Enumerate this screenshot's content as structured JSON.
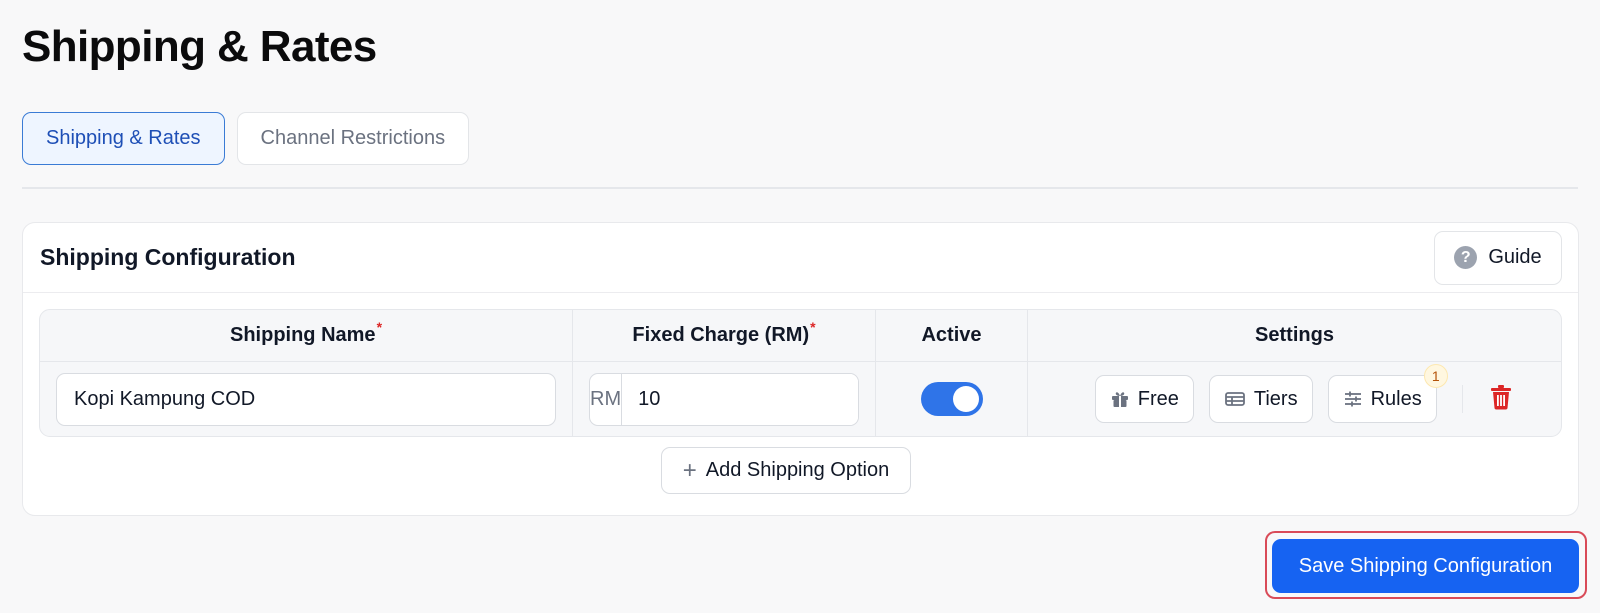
{
  "page": {
    "title": "Shipping & Rates"
  },
  "tabs": [
    {
      "label": "Shipping & Rates",
      "active": true
    },
    {
      "label": "Channel Restrictions",
      "active": false
    }
  ],
  "config": {
    "title": "Shipping Configuration",
    "guide_label": "Guide",
    "guide_icon": "?",
    "columns": {
      "name": "Shipping Name",
      "charge": "Fixed Charge (RM)",
      "active": "Active",
      "settings": "Settings"
    },
    "required_mark": "*",
    "rows": [
      {
        "name": "Kopi Kampung COD",
        "currency_prefix": "RM",
        "charge": "10",
        "active": true,
        "settings": {
          "free_label": "Free",
          "tiers_label": "Tiers",
          "rules_label": "Rules",
          "rules_badge": "1"
        }
      }
    ],
    "add_label": "Add Shipping Option",
    "add_icon": "+"
  },
  "save_label": "Save Shipping Configuration",
  "colors": {
    "primary": "#1663f2",
    "toggle_on": "#2f74e8",
    "danger": "#dc2626",
    "highlight_ring": "#d94b58"
  }
}
